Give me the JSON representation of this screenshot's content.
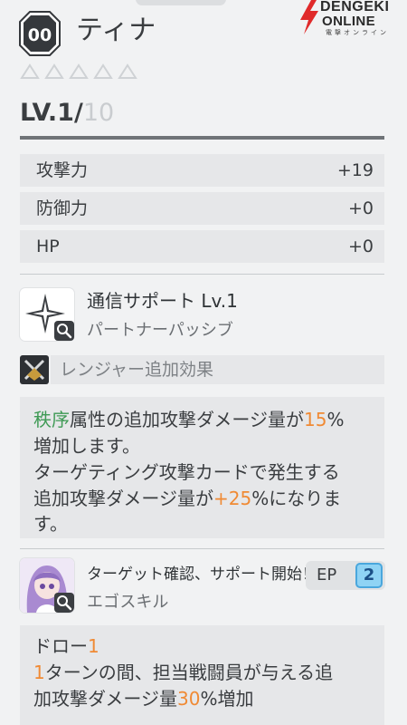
{
  "watermark": {
    "line1": "DENGEKI",
    "line2": "ONLINE",
    "line3": "電撃オンライン"
  },
  "character": {
    "badge": "00",
    "name": "ティナ",
    "rarity": {
      "filled": 0,
      "total": 5
    },
    "level": {
      "current": "LV.1/",
      "max": "10"
    }
  },
  "stats": [
    {
      "label": "攻撃力",
      "value": "+19"
    },
    {
      "label": "防御力",
      "value": "+0"
    },
    {
      "label": "HP",
      "value": "+0"
    }
  ],
  "passive": {
    "title": "通信サポート Lv.1",
    "subtitle": "パートナーパッシブ",
    "icon": "sparkle-icon",
    "ranger_bonus": "レンジャー追加効果",
    "description": {
      "attr": "秩序",
      "t1": "属性の追加攻撃ダメージ量が",
      "v1": "15",
      "t2": "%",
      "line2": "増加します。",
      "line3": "ターゲティング攻撃カードで発生する",
      "t4": "追加攻撃ダメージ量が",
      "v2": "+25",
      "t5": "%になりま",
      "line5": "す。"
    }
  },
  "ego": {
    "title": "ターゲット確認、サポート開始！",
    "subtitle": "エゴスキル",
    "ep_label": "EP",
    "ep_value": "2",
    "description": {
      "t1": "ドロー",
      "v1": "1",
      "v2": "1",
      "t2": "ターンの間、担当戦闘員が与える追",
      "t3": "加攻撃ダメージ量",
      "v3": "30",
      "t4": "%増加"
    }
  },
  "colors": {
    "accent_orange": "#f08a34",
    "attribute_green": "#3f9a55",
    "ep_blue": "#8fd3f4"
  }
}
